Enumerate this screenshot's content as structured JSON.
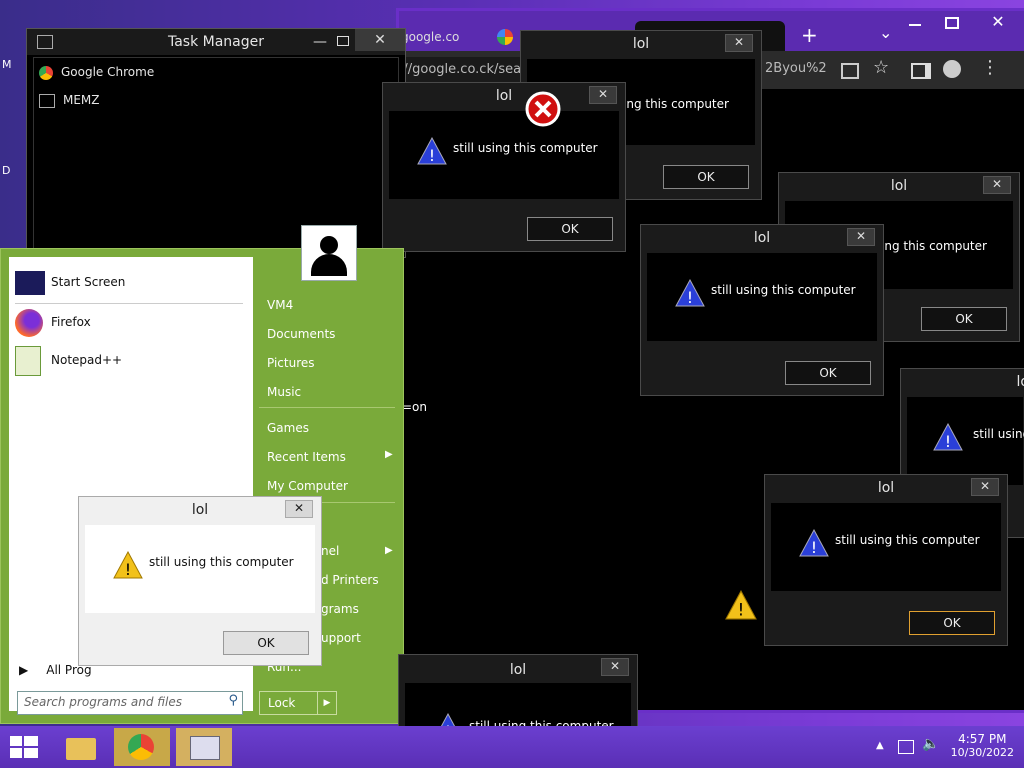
{
  "desktop": {
    "icon_labels": [
      "M",
      "D"
    ],
    "stray_text": "=on"
  },
  "chrome": {
    "tab_label": "google.co",
    "address_fragment": "://google.co.ck/sea",
    "address_fragment_right": "2Byou%2",
    "new_tab_symbol": "+",
    "dropdown_symbol": "⌄"
  },
  "task_manager": {
    "title": "Task Manager",
    "items": [
      {
        "label": "Google Chrome",
        "icon": "chrome-icon"
      },
      {
        "label": "MEMZ",
        "icon": "memz-icon"
      }
    ]
  },
  "dialogs": [
    {
      "title": "lol",
      "message": "ing this computer",
      "ok": "OK"
    },
    {
      "title": "lol",
      "message": "still using this computer",
      "ok": "OK"
    },
    {
      "title": "lol",
      "message": "ing this computer",
      "ok": "OK"
    },
    {
      "title": "lol",
      "message": "still using this computer",
      "ok": "OK"
    },
    {
      "title": "lo",
      "message": "still using",
      "ok": ""
    },
    {
      "title": "lol",
      "message": "still using this computer",
      "ok": "OK"
    },
    {
      "title": "lol",
      "message": "still using this computer",
      "ok": "OK"
    },
    {
      "title": "lol",
      "message": "still using this computer",
      "ok": ""
    }
  ],
  "start_menu": {
    "left_items": [
      {
        "label": "Start Screen",
        "icon": "start-screen-icon"
      },
      {
        "label": "Firefox",
        "icon": "firefox-icon"
      },
      {
        "label": "Notepad++",
        "icon": "notepadpp-icon"
      }
    ],
    "all_programs": "All Prog",
    "search_placeholder": "Search programs and files",
    "right_items": [
      "VM4",
      "Documents",
      "Pictures",
      "Music",
      "Games",
      "Recent Items",
      "My Computer",
      "nel",
      "d Printers",
      "grams",
      "upport",
      "Run..."
    ],
    "lock_label": "Lock"
  },
  "taskbar": {
    "time": "4:57 PM",
    "date": "10/30/2022"
  },
  "colors": {
    "start_green": "#7aaa3a",
    "taskbar_purple": "#5a2fb5",
    "chrome_frame": "#6a2fc8"
  }
}
